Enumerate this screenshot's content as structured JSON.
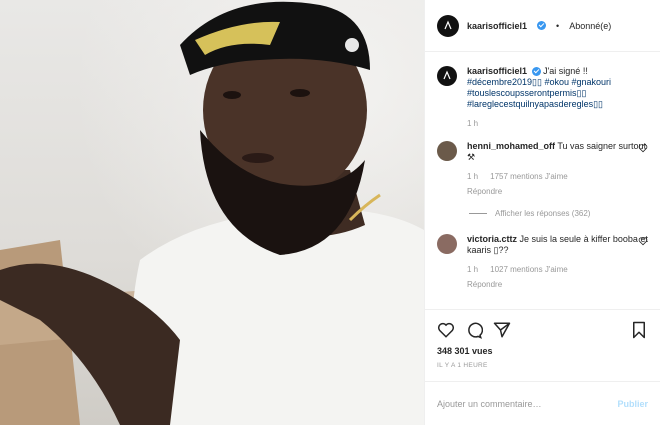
{
  "header": {
    "username": "kaarisofficiel1",
    "separator": "•",
    "follow_label": "Abonné(e)"
  },
  "caption": {
    "username": "kaarisofficiel1",
    "text": "J'ai signé !!",
    "hashtags": "#décembre2019▯▯ #okou #gnakouri #touslescoupsserontpermis▯▯ #lareglecestquilnyapasderegles▯▯",
    "time": "1 h"
  },
  "comments": [
    {
      "username": "henni_mohamed_off",
      "text": "Tu vas saigner surtout ⚒",
      "time": "1 h",
      "likes": "1757 mentions J'aime",
      "reply": "Répondre"
    },
    {
      "username": "victoria.cttz",
      "text": "Je suis la seule à kiffer booba et kaaris ▯??",
      "time": "1 h",
      "likes": "1027 mentions J'aime",
      "reply": "Répondre"
    }
  ],
  "view_replies": "Afficher les réponses (362)",
  "stats": {
    "views": "348 301 vues",
    "posted": "IL Y A 1 HEURE"
  },
  "comment_box": {
    "placeholder": "Ajouter un commentaire…",
    "publish_label": "Publier"
  },
  "icons": {
    "like": "heart-icon",
    "comment": "comment-bubble-icon",
    "share": "paper-plane-icon",
    "save": "bookmark-icon"
  },
  "colors": {
    "verified": "#3897f0",
    "link": "#003569",
    "muted": "#999999",
    "publish_disabled": "#b2dffc"
  }
}
